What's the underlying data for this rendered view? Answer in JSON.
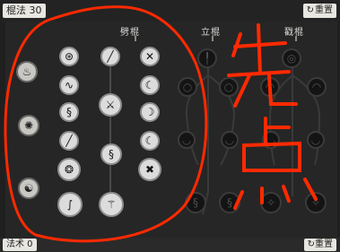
{
  "top": {
    "counter_label": "棍法 30",
    "reset_label": "重置",
    "reset_icon": "↻"
  },
  "bottom": {
    "counter_label": "法术 0",
    "reset_label": "重置",
    "reset_icon": "↻"
  },
  "branches": {
    "pi": "劈棍",
    "li": "立棍",
    "chuo": "戳棍"
  },
  "annotation": {
    "text": "先点",
    "color": "#ff2a00",
    "note": "hand-drawn red circle around 劈棍 column"
  },
  "side_icons": [
    "flame-talisman-icon",
    "spirit-orb-icon",
    "monk-head-icon"
  ],
  "pi_nodes": [
    "spiral",
    "staff",
    "cross-staff",
    "spiral",
    "staff",
    "crescent",
    "swirl",
    "staff",
    "crescent",
    "staff",
    "swirl",
    "crescent",
    "swirl",
    "staff",
    "cross",
    "swirl",
    "staff"
  ],
  "li_nodes": [
    "staff",
    "ring",
    "ring",
    "arc",
    "arc",
    "swirl",
    "swirl",
    "swirl"
  ],
  "chuo_nodes": [
    "ring",
    "arc",
    "arc",
    "arc",
    "arc",
    "arc",
    "arc",
    "arc"
  ]
}
